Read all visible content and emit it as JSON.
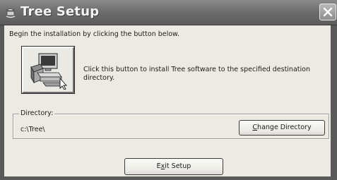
{
  "window": {
    "title": "Tree Setup",
    "icons": {
      "app": "setup-app-icon",
      "close": "close-icon",
      "install": "computer-install-icon"
    }
  },
  "intro_text": "Begin the installation by clicking the button below.",
  "install": {
    "description": "Click this button to install Tree software to the specified destination directory."
  },
  "directory": {
    "label": "Directory:",
    "value": "c:\\Tree\\"
  },
  "buttons": {
    "change_directory_accel": "C",
    "change_directory_rest": "hange Directory",
    "exit_setup_pre": "E",
    "exit_setup_accel": "x",
    "exit_setup_rest": "it Setup"
  }
}
